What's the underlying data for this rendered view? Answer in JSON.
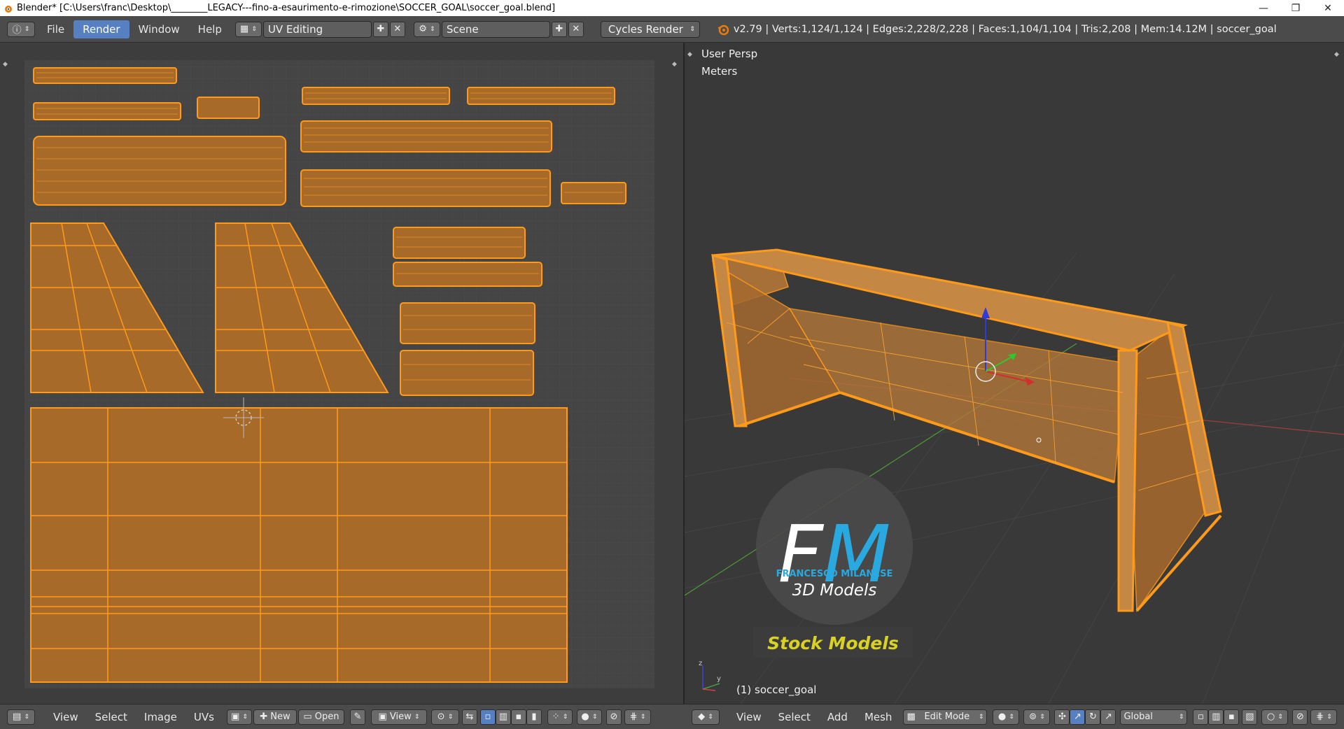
{
  "window": {
    "title": "Blender* [C:\\Users\\franc\\Desktop\\________LEGACY---fino-a-esaurimento-e-rimozione\\SOCCER_GOAL\\soccer_goal.blend]",
    "minimize": "—",
    "maximize": "❐",
    "close": "✕"
  },
  "topbar": {
    "menus": [
      "File",
      "Render",
      "Window",
      "Help"
    ],
    "active_menu": "Render",
    "screen_layout": "UV Editing",
    "scene": "Scene",
    "render_engine": "Cycles Render",
    "stats": "v2.79 | Verts:1,124/1,124 | Edges:2,228/2,228 | Faces:1,104/1,104 | Tris:2,208 | Mem:14.12M | soccer_goal"
  },
  "viewport": {
    "view_name": "User Persp",
    "units": "Meters",
    "object_label": "(1) soccer_goal",
    "watermark": {
      "monogram": "FM",
      "author": "FRANCESCO MILANESE",
      "subtitle": "3D Models",
      "banner": "Stock Models"
    }
  },
  "uv_header": {
    "menus": [
      "View",
      "Select",
      "Image",
      "UVs"
    ],
    "new_label": "New",
    "open_label": "Open",
    "view_label": "View"
  },
  "viewport_header": {
    "menus": [
      "View",
      "Select",
      "Add",
      "Mesh"
    ],
    "mode": "Edit Mode",
    "orientation": "Global"
  },
  "colors": {
    "accent_blue": "#5680c2",
    "uv_fill": "#a86a28",
    "uv_edge": "#ff9a1a",
    "mesh_fill": "#b3773a",
    "header_bg": "#4b4b4b",
    "watermark_blue": "#29a9e0",
    "watermark_yellow": "#d9d222"
  },
  "icons": {
    "info": "info-icon",
    "layout": "screen-layout-icon",
    "add": "plus-icon",
    "remove": "x-icon",
    "scene": "scene-icon",
    "blender": "blender-logo-icon"
  }
}
